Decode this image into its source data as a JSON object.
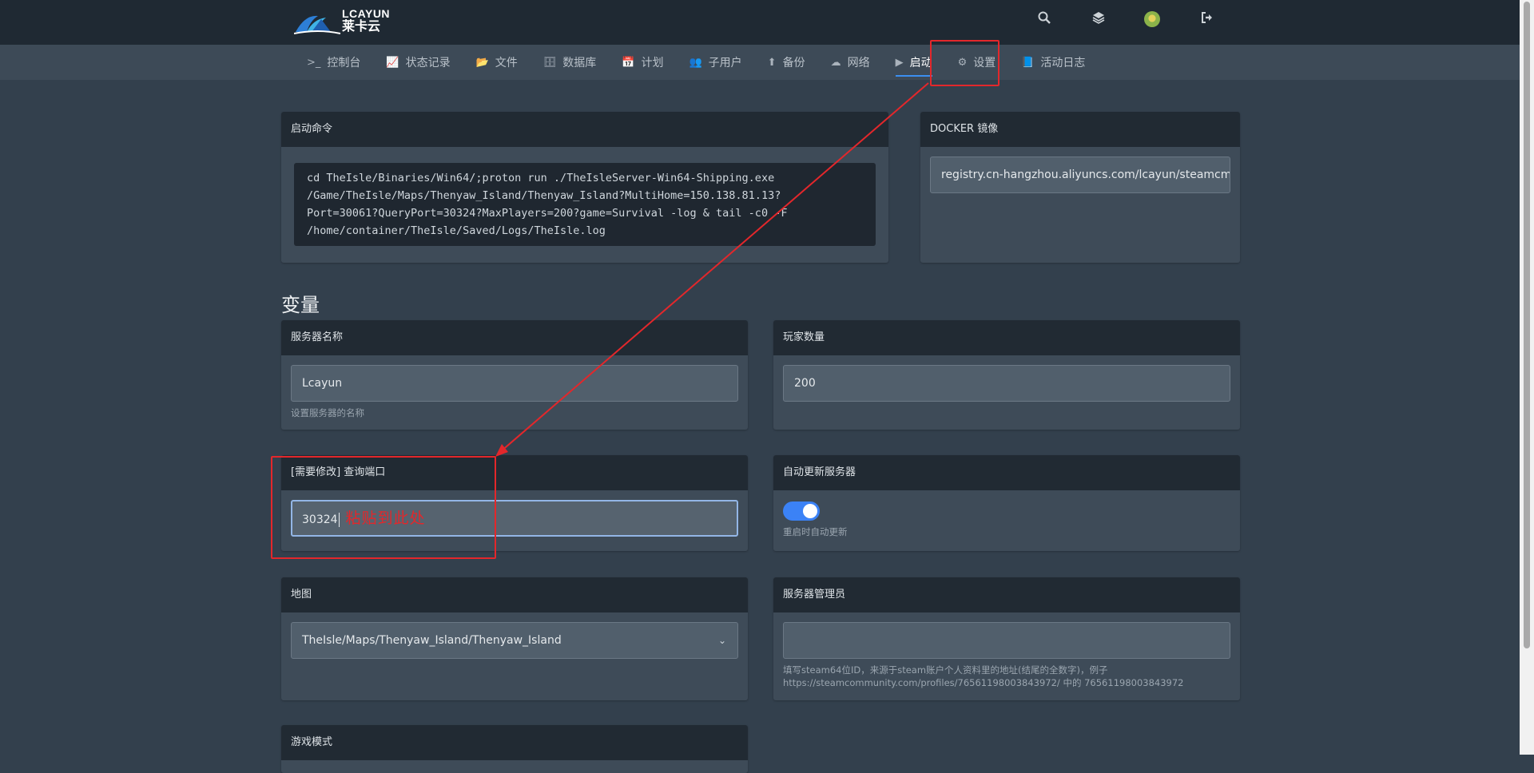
{
  "brand": {
    "en": "LCAYUN",
    "cn": "莱卡云"
  },
  "topbar": {
    "icons": [
      "search-icon",
      "layers-icon",
      "avatar",
      "logout-icon"
    ]
  },
  "nav": [
    {
      "icon": ">_",
      "label": "控制台"
    },
    {
      "icon": "📈",
      "label": "状态记录"
    },
    {
      "icon": "📂",
      "label": "文件"
    },
    {
      "icon": "🗄",
      "label": "数据库"
    },
    {
      "icon": "📅",
      "label": "计划"
    },
    {
      "icon": "👥",
      "label": "子用户"
    },
    {
      "icon": "⬆",
      "label": "备份"
    },
    {
      "icon": "☁",
      "label": "网络"
    },
    {
      "icon": "▶",
      "label": "启动"
    },
    {
      "icon": "⚙",
      "label": "设置"
    },
    {
      "icon": "📘",
      "label": "活动日志"
    }
  ],
  "startup": {
    "title": "启动命令",
    "command": "cd TheIsle/Binaries/Win64/;proton run ./TheIsleServer-Win64-Shipping.exe\n/Game/TheIsle/Maps/Thenyaw_Island/Thenyaw_Island?MultiHome=150.138.81.13?\nPort=30061?QueryPort=30324?MaxPlayers=200?game=Survival -log & tail -c0 -F\n/home/container/TheIsle/Saved/Logs/TheIsle.log"
  },
  "docker": {
    "title": "DOCKER 镜像",
    "value": "registry.cn-hangzhou.aliyuncs.com/lcayun/steamcmd"
  },
  "variables_title": "变量",
  "server_name": {
    "title": "服务器名称",
    "value": "Lcayun",
    "hint": "设置服务器的名称"
  },
  "player_count": {
    "title": "玩家数量",
    "value": "200"
  },
  "query_port": {
    "title": "[需要修改] 查询端口",
    "value": "30324",
    "annotation": "粘贴到此处"
  },
  "auto_update": {
    "title": "自动更新服务器",
    "enabled": true,
    "hint": "重启时自动更新"
  },
  "map": {
    "title": "地图",
    "value": "TheIsle/Maps/Thenyaw_Island/Thenyaw_Island"
  },
  "admins": {
    "title": "服务器管理员",
    "value": "",
    "hint_line1": "填写steam64位ID，来源于steam账户个人资料里的地址(结尾的全数字)，例子",
    "hint_line2": "https://steamcommunity.com/profiles/76561198003843972/ 中的 76561198003843972"
  },
  "game_mode": {
    "title": "游戏模式"
  }
}
